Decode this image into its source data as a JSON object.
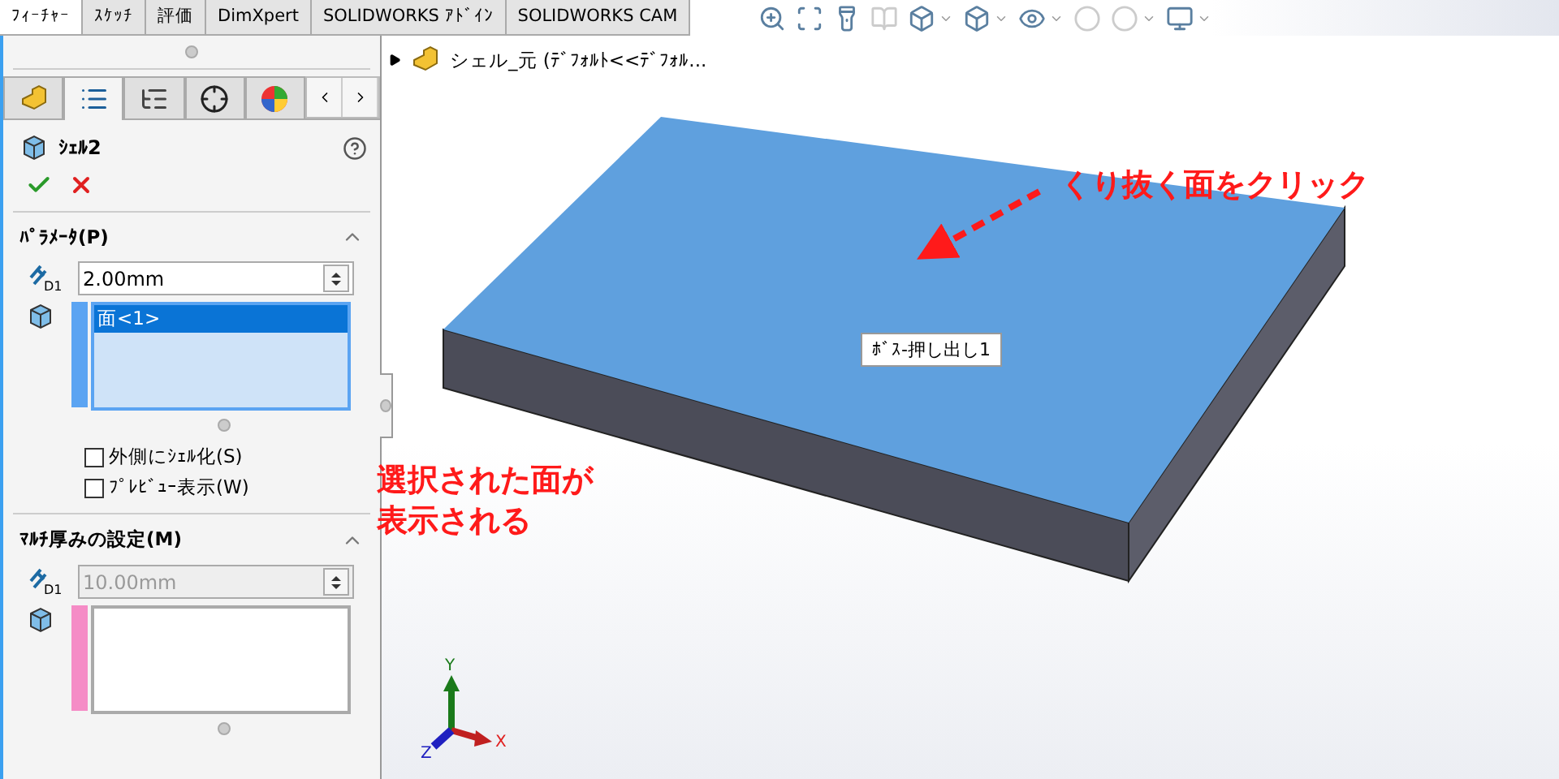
{
  "tabs": [
    {
      "label": "ﾌｨｰﾁｬｰ",
      "selected": true
    },
    {
      "label": "ｽｹｯﾁ",
      "selected": false
    },
    {
      "label": "評価",
      "selected": false
    },
    {
      "label": "DimXpert",
      "selected": false
    },
    {
      "label": "SOLIDWORKS ｱﾄﾞｲﾝ",
      "selected": false
    },
    {
      "label": "SOLIDWORKS CAM",
      "selected": false
    }
  ],
  "panel": {
    "tabs": [
      {
        "kind": "features",
        "selected": false
      },
      {
        "kind": "properties",
        "selected": true
      },
      {
        "kind": "configurations",
        "selected": false
      },
      {
        "kind": "dimxpert",
        "selected": false
      },
      {
        "kind": "appearance",
        "selected": false
      }
    ],
    "title": "ｼｪﾙ2",
    "sections": [
      {
        "title": "ﾊﾟﾗﾒｰﾀ(P)",
        "expanded": true,
        "dim_label": "D1",
        "thickness": "2.00mm",
        "disabled": false,
        "color": "#5ba4f2",
        "faces": [
          {
            "label": "面<1>",
            "selected": true
          }
        ],
        "options": [
          {
            "label": "外側にｼｪﾙ化(S)",
            "checked": false
          },
          {
            "label": "ﾌﾟﾚﾋﾞｭｰ表示(W)",
            "checked": false
          }
        ]
      },
      {
        "title": "ﾏﾙﾁ厚みの設定(M)",
        "expanded": true,
        "dim_label": "D1",
        "thickness": "10.00mm",
        "disabled": true,
        "color": "#f58cc6"
      }
    ]
  },
  "viewport": {
    "tree_root": "シェル_元 (ﾃﾞﾌｫﾙﾄ<<ﾃﾞﾌｫﾙ...",
    "tooltip": "ﾎﾞｽ-押し出し1",
    "axes": [
      "X",
      "Y",
      "Z"
    ],
    "annotations": [
      "くり抜く面をクリック",
      "選択された面が表示される"
    ]
  }
}
